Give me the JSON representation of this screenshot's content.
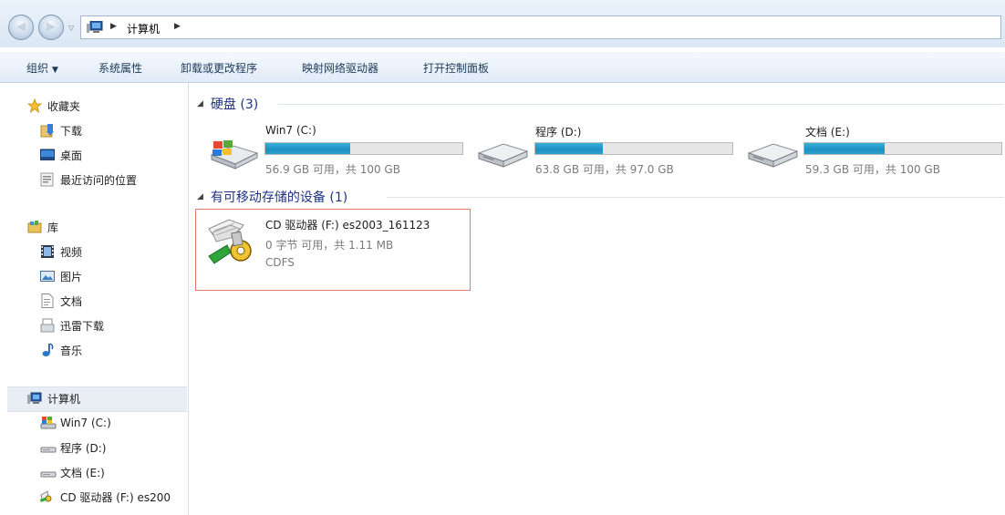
{
  "address": {
    "crumbs": [
      "计算机"
    ]
  },
  "toolbar": {
    "organize": "组织",
    "system_properties": "系统属性",
    "uninstall": "卸载或更改程序",
    "map_drive": "映射网络驱动器",
    "control_panel": "打开控制面板"
  },
  "nav": {
    "favorites": {
      "label": "收藏夹",
      "items": [
        "下载",
        "桌面",
        "最近访问的位置"
      ]
    },
    "libraries": {
      "label": "库",
      "items": [
        "视频",
        "图片",
        "文档",
        "迅雷下载",
        "音乐"
      ]
    },
    "computer": {
      "label": "计算机",
      "items": [
        "Win7 (C:)",
        "程序 (D:)",
        "文档 (E:)",
        "CD 驱动器 (F:) es200"
      ]
    }
  },
  "groups": {
    "hard_disks": "硬盘 (3)",
    "removable": "有可移动存储的设备 (1)"
  },
  "drives": [
    {
      "name": "Win7 (C:)",
      "free": "56.9 GB 可用，共 100 GB",
      "used_fraction": 0.431
    },
    {
      "name": "程序 (D:)",
      "free": "63.8 GB 可用，共 97.0 GB",
      "used_fraction": 0.342
    },
    {
      "name": "文档 (E:)",
      "free": "59.3 GB 可用，共 100 GB",
      "used_fraction": 0.407
    }
  ],
  "cd_drive": {
    "name": "CD 驱动器 (F:) es2003_161123",
    "free": "0 字节 可用，共 1.11 MB",
    "fs": "CDFS"
  },
  "colors": {
    "bar_fill": "#1e8fc0",
    "group_header": "#1e3287",
    "selection_border": "#e07a6a"
  }
}
